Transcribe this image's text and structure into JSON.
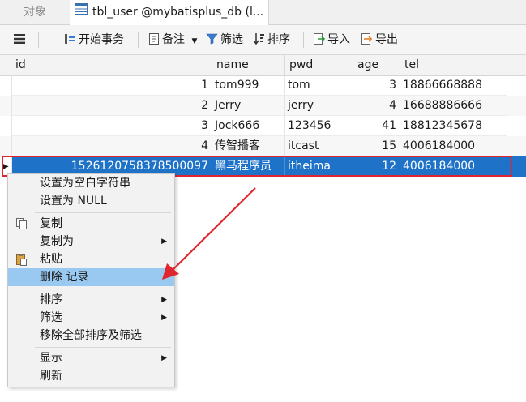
{
  "tabs": [
    {
      "label": "对象"
    },
    {
      "label": "tbl_user @mybatisplus_db (l..."
    }
  ],
  "toolbar": {
    "menu_icon": "hamburger-icon",
    "begin_transaction": "开始事务",
    "memo": "备注",
    "filter": "筛选",
    "sort": "排序",
    "import": "导入",
    "export": "导出"
  },
  "grid": {
    "columns": [
      "id",
      "name",
      "pwd",
      "age",
      "tel"
    ],
    "rows": [
      {
        "id": "1",
        "name": "tom999",
        "pwd": "tom",
        "age": "3",
        "tel": "18866668888"
      },
      {
        "id": "2",
        "name": "Jerry",
        "pwd": "jerry",
        "age": "4",
        "tel": "16688886666"
      },
      {
        "id": "3",
        "name": "Jock666",
        "pwd": "123456",
        "age": "41",
        "tel": "18812345678"
      },
      {
        "id": "4",
        "name": "传智播客",
        "pwd": "itcast",
        "age": "15",
        "tel": "4006184000"
      },
      {
        "id": "1526120758378500097",
        "name": "黑马程序员",
        "pwd": "itheima",
        "age": "12",
        "tel": "4006184000"
      }
    ],
    "selected_row_index": 4
  },
  "context_menu": {
    "items": [
      {
        "label": "设置为空白字符串"
      },
      {
        "label": "设置为 NULL"
      },
      {
        "label": "复制"
      },
      {
        "label": "复制为"
      },
      {
        "label": "粘贴"
      },
      {
        "label": "删除 记录"
      },
      {
        "label": "排序"
      },
      {
        "label": "筛选"
      },
      {
        "label": "移除全部排序及筛选"
      },
      {
        "label": "显示"
      },
      {
        "label": "刷新"
      }
    ],
    "highlighted": "删除 记录"
  },
  "colors": {
    "selection": "#1e73c8",
    "menu_highlight": "#99c9f1",
    "annotation_red": "#e0262c"
  }
}
